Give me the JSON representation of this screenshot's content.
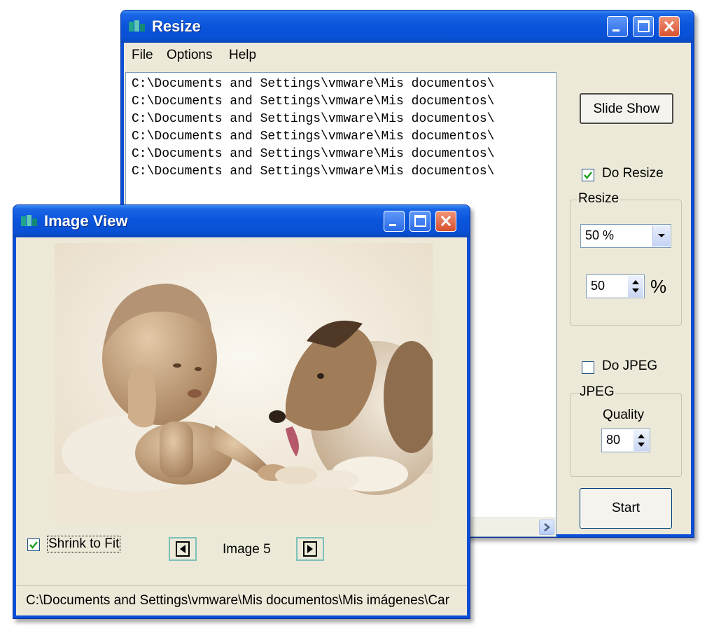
{
  "resize_window": {
    "title": "Resize",
    "menu": [
      "File",
      "Options",
      "Help"
    ],
    "file_list": [
      "C:\\Documents and Settings\\vmware\\Mis documentos\\",
      "C:\\Documents and Settings\\vmware\\Mis documentos\\",
      "C:\\Documents and Settings\\vmware\\Mis documentos\\",
      "C:\\Documents and Settings\\vmware\\Mis documentos\\",
      "C:\\Documents and Settings\\vmware\\Mis documentos\\",
      "C:\\Documents and Settings\\vmware\\Mis documentos\\"
    ],
    "slide_show_label": "Slide Show",
    "do_resize": {
      "label": "Do Resize",
      "checked": true
    },
    "resize_group": {
      "label": "Resize",
      "combo_value": "50 %",
      "spin_value": "50",
      "unit": "%"
    },
    "do_jpeg": {
      "label": "Do JPEG",
      "checked": false
    },
    "jpeg_group": {
      "label": "JPEG",
      "quality_label": "Quality",
      "quality_value": "80"
    },
    "start_label": "Start"
  },
  "image_window": {
    "title": "Image View",
    "shrink_to_fit": {
      "label": "Shrink to Fit",
      "checked": true
    },
    "image_label": "Image 5",
    "status_path": "C:\\Documents and Settings\\vmware\\Mis documentos\\Mis imágenes\\Car"
  },
  "colors": {
    "titlebar": "#0a55dc",
    "window_bg": "#ece9d8",
    "close_button": "#d6502f",
    "sepia_photo": "#c9a98a"
  },
  "icons": [
    "app-icon",
    "minimize-icon",
    "maximize-icon",
    "close-icon",
    "combo-arrow-icon",
    "spin-up-icon",
    "spin-down-icon",
    "scroll-right-icon",
    "prev-image-icon",
    "next-image-icon",
    "checkmark-icon"
  ]
}
